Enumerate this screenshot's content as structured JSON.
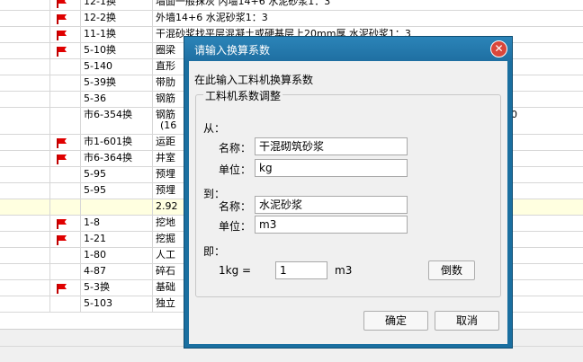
{
  "rows": [
    {
      "flag": true,
      "code": "12-1换",
      "desc": "墙面一般抹灰 内墙14+6 水泥砂浆1：3",
      "hl": false
    },
    {
      "flag": true,
      "code": "12-2换",
      "desc": "外墙14+6 水泥砂浆1：3",
      "hl": false
    },
    {
      "flag": true,
      "code": "11-1换",
      "desc": "干混砂浆找平层混凝土或硬基层上20mm厚 水泥砂浆1：3",
      "hl": false
    },
    {
      "flag": true,
      "code": "5-10换",
      "desc": "圈梁",
      "hl": false
    },
    {
      "flag": false,
      "code": "5-140",
      "desc": "直形",
      "hl": false
    },
    {
      "flag": false,
      "code": "5-39换",
      "desc": "带肋",
      "hl": false
    },
    {
      "flag": false,
      "code": "5-36",
      "desc": "钢筋",
      "hl": false
    },
    {
      "flag": false,
      "code": "市6-354换",
      "desc": "钢筋",
      "desc2": "(16",
      "tail": "0",
      "hl": false,
      "tall": true
    },
    {
      "flag": true,
      "code": "市1-601换",
      "desc": "运距",
      "hl": false
    },
    {
      "flag": true,
      "code": "市6-364换",
      "desc": "井室",
      "hl": false
    },
    {
      "flag": false,
      "code": "5-95",
      "desc": "预埋",
      "hl": false
    },
    {
      "flag": false,
      "code": "5-95",
      "desc": "预埋",
      "hl": false
    },
    {
      "flag": false,
      "code": "",
      "desc": "2.92",
      "hl": true
    },
    {
      "flag": true,
      "code": "1-8",
      "desc": "挖地",
      "hl": false
    },
    {
      "flag": true,
      "code": "1-21",
      "desc": "挖掘",
      "hl": false
    },
    {
      "flag": false,
      "code": "1-80",
      "desc": "人工",
      "hl": false
    },
    {
      "flag": false,
      "code": "4-87",
      "desc": "碎石",
      "hl": false
    },
    {
      "flag": true,
      "code": "5-3换",
      "desc": "基础",
      "hl": false
    },
    {
      "flag": false,
      "code": "5-103",
      "desc": "独立",
      "hl": false
    }
  ],
  "dialog": {
    "title": "请输入换算系数",
    "close_glyph": "✕",
    "hint": "在此输入工料机换算系数",
    "group_title": "工料机系数调整",
    "from_label": "从：",
    "from_name_label": "名称：",
    "from_name_value": "干混砌筑砂浆",
    "from_unit_label": "单位：",
    "from_unit_value": "kg",
    "to_label": "到：",
    "to_name_label": "名称：",
    "to_name_value": "水泥砂浆",
    "to_unit_label": "单位：",
    "to_unit_value": "m3",
    "ratio_label": "即：",
    "ratio_left": "1kg =",
    "ratio_value": "1",
    "ratio_right": "m3",
    "reciprocal_button": "倒数",
    "ok_button": "确定",
    "cancel_button": "取消"
  },
  "colors": {
    "flag": "#e00000",
    "dialog_frame": "#1a6fa0",
    "close": "#d9473b",
    "highlight_row": "#ffffe0"
  }
}
